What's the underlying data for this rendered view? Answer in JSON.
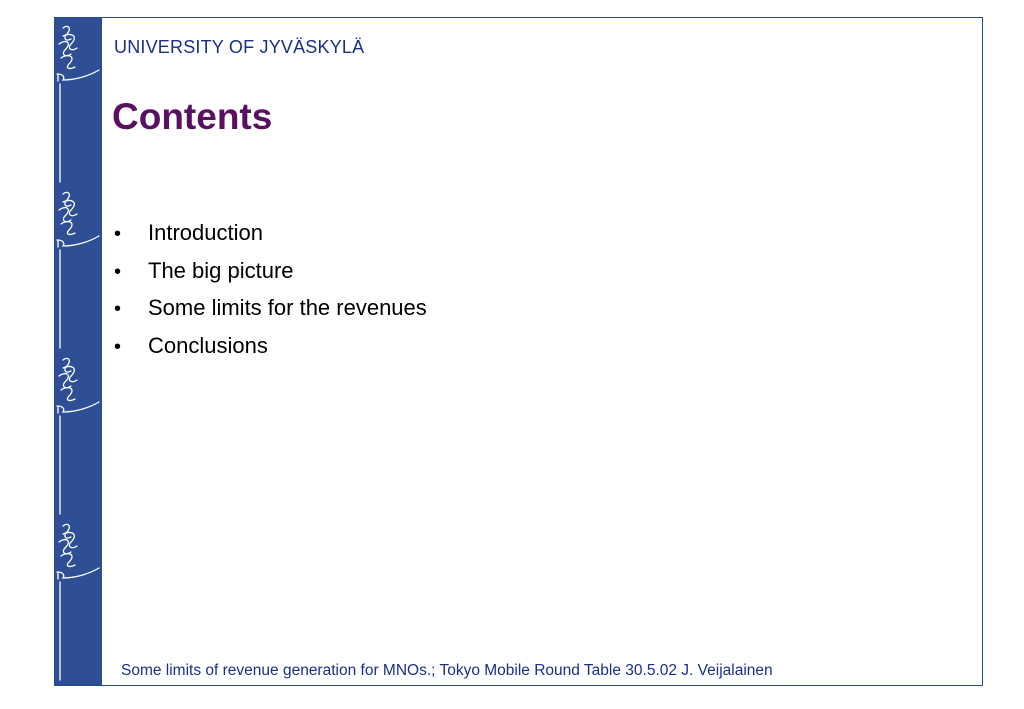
{
  "header": {
    "university": "UNIVERSITY OF JYVÄSKYLÄ"
  },
  "slide": {
    "title": "Contents",
    "bullets": [
      "Introduction",
      "The big picture",
      "Some limits for the revenues",
      "Conclusions"
    ]
  },
  "footer": {
    "text": "Some limits of revenue generation for MNOs.; Tokyo Mobile Round Table 30.5.02 J. Veijalainen"
  },
  "colors": {
    "sidebar": "#2e4f96",
    "university_text": "#1a2f8a",
    "title": "#5a1060",
    "footer_text": "#1a2f8a"
  },
  "icons": {
    "sidebar_emblem": "university-torch-logo-icon"
  }
}
